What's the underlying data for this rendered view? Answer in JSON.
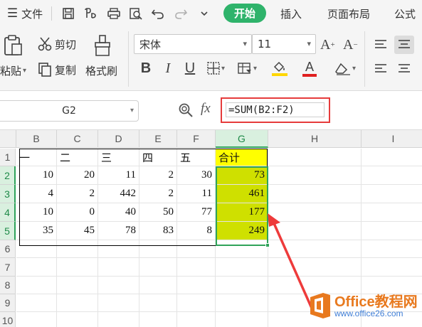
{
  "menubar": {
    "file_label": "文件",
    "start_label": "开始",
    "insert_label": "插入",
    "layout_label": "页面布局",
    "formula_label": "公式"
  },
  "ribbon": {
    "cut_label": "剪切",
    "paste_label": "粘贴",
    "copy_label": "复制",
    "format_painter_label": "格式刷",
    "font_name": "宋体",
    "font_size": "11",
    "bold": "B",
    "italic": "I",
    "underline": "U",
    "font_color_glyph": "A",
    "accent_color": "#2fb36b",
    "font_color_bar": "#e02020",
    "fill_color_bar": "#ffd700"
  },
  "formula_bar": {
    "cell_ref": "G2",
    "fx_label": "fx",
    "formula": "=SUM(B2:F2)"
  },
  "grid": {
    "columns": [
      "B",
      "C",
      "D",
      "E",
      "F",
      "G",
      "H",
      "I"
    ],
    "selected_column": "G",
    "rows": [
      "1",
      "2",
      "3",
      "4",
      "5",
      "6",
      "7",
      "8",
      "9",
      "10"
    ],
    "selected_rows": [
      "2",
      "3",
      "4",
      "5"
    ],
    "header_row": [
      "一",
      "二",
      "三",
      "四",
      "五",
      "合计"
    ],
    "data": [
      [
        "10",
        "20",
        "11",
        "2",
        "30",
        "73"
      ],
      [
        "4",
        "2",
        "442",
        "2",
        "11",
        "461"
      ],
      [
        "10",
        "0",
        "40",
        "50",
        "77",
        "177"
      ],
      [
        "35",
        "45",
        "78",
        "83",
        "8",
        "249"
      ]
    ]
  },
  "watermark": {
    "title": "Office教程网",
    "url": "www.office26.com"
  }
}
